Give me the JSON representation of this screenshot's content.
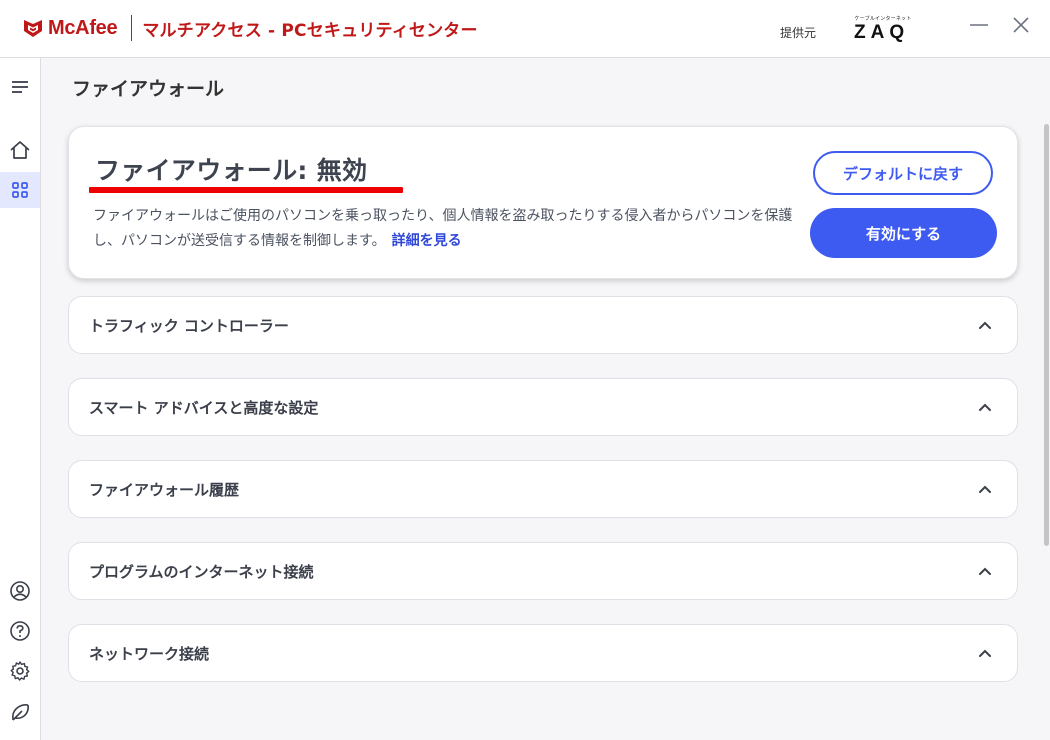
{
  "window": {
    "brand": "McAfee",
    "app_title": "マルチアクセス - PCセキュリティセンター",
    "provider_label": "提供元",
    "partner_logo_small": "ケーブルインターネット",
    "partner_logo_main": "ZAQ"
  },
  "sidebar": {
    "items": [
      {
        "icon": "menu-icon"
      },
      {
        "icon": "home-icon"
      },
      {
        "icon": "apps-grid-icon",
        "active": true
      },
      {
        "icon": "account-icon"
      },
      {
        "icon": "help-icon"
      },
      {
        "icon": "settings-icon"
      },
      {
        "icon": "feedback-icon"
      }
    ]
  },
  "page": {
    "title": "ファイアウォール"
  },
  "status_card": {
    "title": "ファイアウォール: 無効",
    "description": "ファイアウォールはご使用のパソコンを乗っ取ったり、個人情報を盗み取ったりする侵入者からパソコンを保護し、パソコンが送受信する情報を制御します。",
    "link_label": "詳細を見る",
    "restore_default_label": "デフォルトに戻す",
    "enable_label": "有効にする"
  },
  "sections": [
    {
      "label": "トラフィック コントローラー"
    },
    {
      "label": "スマート アドバイスと高度な設定"
    },
    {
      "label": "ファイアウォール履歴"
    },
    {
      "label": "プログラムのインターネット接続"
    },
    {
      "label": "ネットワーク接続"
    }
  ],
  "colors": {
    "brand_red": "#c01818",
    "accent_blue": "#3d5af1",
    "underline_red": "#ee0000"
  }
}
